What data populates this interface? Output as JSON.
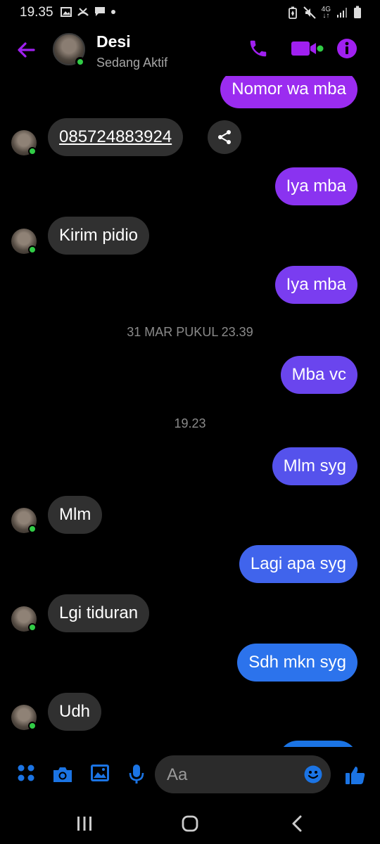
{
  "status_bar": {
    "time": "19.35",
    "network": "4G"
  },
  "header": {
    "contact_name": "Desi",
    "status": "Sedang Aktif"
  },
  "messages": [
    {
      "dir": "out",
      "text": "Nomor wa mba",
      "color": "#9b2cf0"
    },
    {
      "dir": "in",
      "text": "085724883924",
      "link": true
    },
    {
      "dir": "out",
      "text": "Iya mba",
      "color": "#8a33f0"
    },
    {
      "dir": "in",
      "text": "Kirim pidio"
    },
    {
      "dir": "out",
      "text": "Iya mba",
      "color": "#7a3df0"
    },
    {
      "dir": "sep",
      "text": "31 MAR PUKUL 23.39"
    },
    {
      "dir": "out",
      "text": "Mba vc",
      "color": "#6a45ee"
    },
    {
      "dir": "sep",
      "text": "19.23"
    },
    {
      "dir": "out",
      "text": "Mlm syg",
      "color": "#5552ec"
    },
    {
      "dir": "in",
      "text": "Mlm"
    },
    {
      "dir": "out",
      "text": "Lagi apa syg",
      "color": "#4064ec"
    },
    {
      "dir": "in",
      "text": "Lgi tiduran"
    },
    {
      "dir": "out",
      "text": "Sdh mkn syg",
      "color": "#2c73ec"
    },
    {
      "dir": "in",
      "text": "Udh"
    }
  ],
  "composer": {
    "placeholder": "Aa"
  },
  "colors": {
    "accent": "#a020f0",
    "composer_blue": "#1b74e4",
    "online": "#31cc46",
    "incoming_bubble": "#303030"
  },
  "icons": [
    "back-arrow-icon",
    "phone-icon",
    "video-icon",
    "info-icon",
    "share-icon",
    "apps-icon",
    "camera-icon",
    "gallery-icon",
    "microphone-icon",
    "emoji-icon",
    "thumbs-up-icon",
    "recent-apps-icon",
    "home-icon",
    "nav-back-icon"
  ]
}
